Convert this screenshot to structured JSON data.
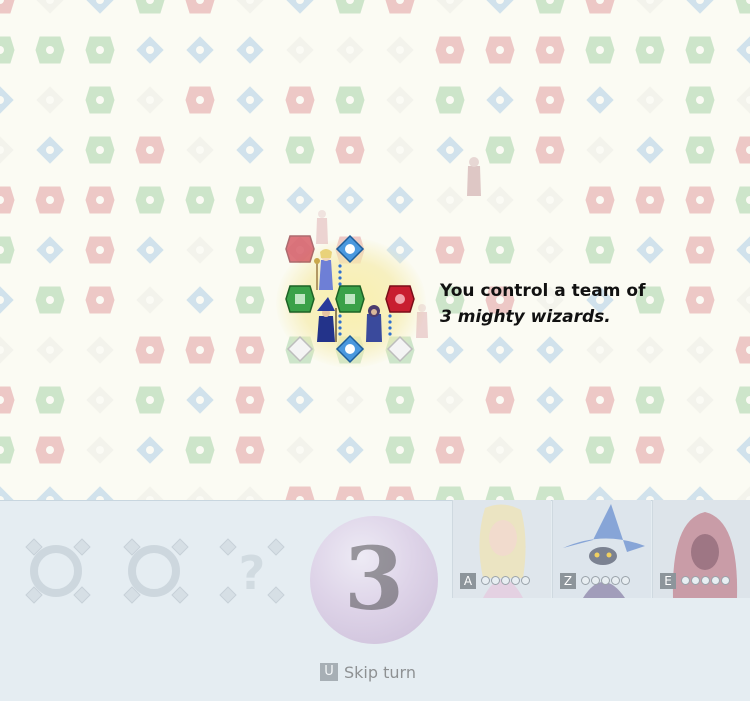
{
  "tutorial": {
    "line1": "You control a team of",
    "line2": "3 mighty wizards."
  },
  "round": {
    "number": "3"
  },
  "wizards": [
    {
      "key": "A",
      "name": "elf-mage",
      "mana_pips": 5,
      "mana_filled": 0
    },
    {
      "key": "Z",
      "name": "blue-hat-wizard",
      "mana_pips": 5,
      "mana_filled": 0
    },
    {
      "key": "E",
      "name": "red-hood-wizard",
      "mana_pips": 5,
      "mana_filled": 0
    }
  ],
  "skip_turn": {
    "key": "U",
    "label": "Skip turn"
  },
  "colors": {
    "board_bg": "#fbfbf3",
    "gem_red": "#c0162a",
    "gem_green": "#2f9a3c",
    "gem_blue": "#3f8fd6",
    "gem_white": "#d8d8d8",
    "panel_bg": "#e5edf2"
  }
}
